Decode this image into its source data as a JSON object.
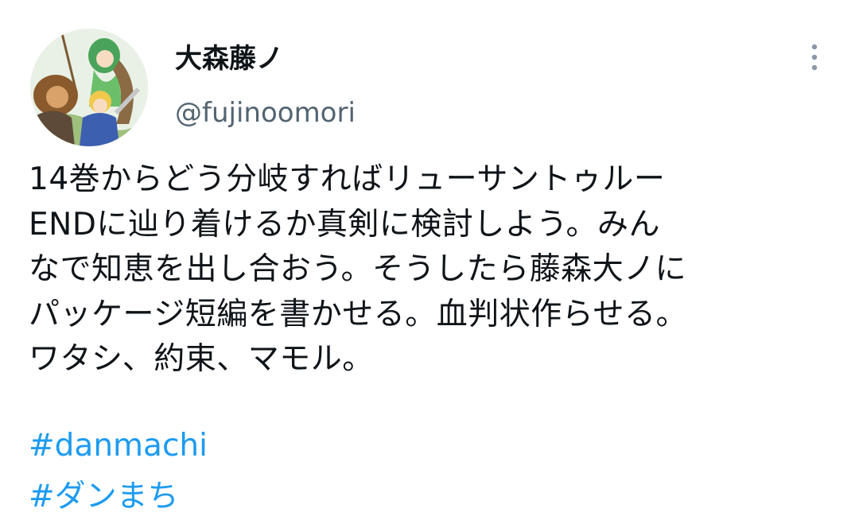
{
  "author": {
    "display_name": "大森藤ノ",
    "handle": "@fujinoomori",
    "avatar_icon": "anime-characters-avatar"
  },
  "menu": {
    "more_icon": "more-vertical-icon"
  },
  "tweet": {
    "lines": [
      "14巻からどう分岐すればリューサントゥルー",
      "ENDに辿り着けるか真剣に検討しよう。みん",
      "なで知恵を出し合おう。そうしたら藤森大ノに",
      "パッケージ短編を書かせる。血判状作らせる。",
      "ワタシ、約束、マモル。"
    ],
    "hashtags": [
      "#danmachi",
      "#ダンまち"
    ]
  },
  "colors": {
    "text": "#0f1419",
    "secondary": "#536471",
    "link": "#1d9bf0"
  }
}
